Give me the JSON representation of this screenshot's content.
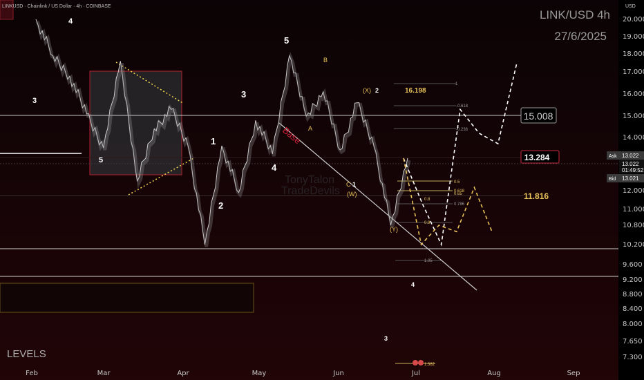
{
  "header": {
    "symbol_line": "LINKUSD · Chainlink / US Dollar · 4h · COINBASE",
    "title": "LINK/USD 4h",
    "date": "27/6/2025",
    "watermark_top": "TonyTalon",
    "watermark_bottom": "TradeDevils",
    "footer_label": "LEVELS"
  },
  "chart_data": {
    "type": "line",
    "title": "LINK/USD 4h",
    "subtitle": "27/6/2025",
    "currency": "USD",
    "ylim": [
      7.0,
      21.0
    ],
    "y_scale": "log",
    "grid": false,
    "y_ticks": [
      "20.000",
      "19.000",
      "18.000",
      "17.000",
      "16.000",
      "15.000",
      "14.000",
      "13.000",
      "12.000",
      "11.000",
      "10.800",
      "10.200",
      "9.600",
      "9.200",
      "8.800",
      "8.400",
      "8.000",
      "7.650",
      "7.300"
    ],
    "x_ticks": [
      "Feb",
      "Mar",
      "Apr",
      "May",
      "Jun",
      "Jul",
      "Aug",
      "Sep"
    ],
    "price_path": [
      [
        "Feb",
        20.6
      ],
      [
        "Feb",
        17.9
      ],
      [
        "Feb",
        16.8
      ],
      [
        "Mar",
        15.1
      ],
      [
        "Mar",
        13.5
      ],
      [
        "Mar",
        17.6
      ],
      [
        "Mar",
        12.3
      ],
      [
        "Mar",
        14.4
      ],
      [
        "Mar",
        15.3
      ],
      [
        "Apr",
        13.6
      ],
      [
        "Apr",
        10.2
      ],
      [
        "Apr",
        13.6
      ],
      [
        "Apr",
        11.9
      ],
      [
        "Apr",
        14.8
      ],
      [
        "May",
        13.2
      ],
      [
        "May",
        17.9
      ],
      [
        "May",
        15.0
      ],
      [
        "Jun",
        16.1
      ],
      [
        "Jun",
        13.4
      ],
      [
        "Jun",
        15.6
      ],
      [
        "Jun",
        13.6
      ],
      [
        "Jun",
        10.8
      ],
      [
        "Jul",
        13.0
      ]
    ],
    "forecast_paths": [
      [
        [
          "Jul",
          13.0
        ],
        [
          "Jul",
          11.3
        ],
        [
          "Jul",
          10.2
        ],
        [
          "Jul",
          15.3
        ],
        [
          "Jul",
          14.2
        ],
        [
          "Aug",
          13.7
        ],
        [
          "Aug",
          17.5
        ]
      ],
      [
        [
          "Jul",
          13.0
        ],
        [
          "Jul",
          10.2
        ],
        [
          "Jul",
          10.8
        ],
        [
          "Jul",
          10.6
        ],
        [
          "Aug",
          12.1
        ],
        [
          "Aug",
          10.6
        ]
      ]
    ],
    "price_labels": {
      "last": "13.022",
      "ask_label": "Ask",
      "ask": "13.022",
      "countdown": "01:49:52",
      "bid_label": "Bid",
      "bid": "13.021"
    },
    "levels": [
      {
        "value": 15.008,
        "label": "15.008"
      },
      {
        "value": 13.284,
        "label": "13.284"
      },
      {
        "value": 11.816,
        "label": "11.816"
      },
      {
        "value": 16.198,
        "label": "16.198"
      }
    ],
    "fib_labels": [
      "-1",
      "-0.618",
      "-0.236",
      "0.5",
      "0.618",
      "0.65",
      "0.8",
      "0.786",
      "0.9",
      "1.05",
      "1.382"
    ],
    "wave_labels": [
      "3",
      "4",
      "5",
      "5",
      "3",
      "1",
      "2",
      "4",
      "5",
      "B",
      "A",
      "(X)",
      "2",
      "C",
      "1",
      "(W)",
      "(Y)",
      "4",
      "3"
    ],
    "annotation_text": "Base",
    "colors": {
      "price": "#8c8c8c",
      "forecast": "#ffffff",
      "box": "#7a1a22",
      "wave_yellow": "#e8c35a",
      "level_red": "#c92a3d"
    }
  }
}
